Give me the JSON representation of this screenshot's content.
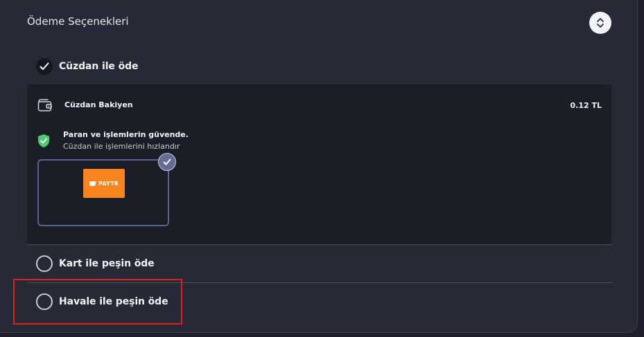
{
  "panel": {
    "title": "Ödeme Seçenekleri",
    "collapse_icon": "chevron-up-down-icon"
  },
  "options": {
    "wallet": {
      "label": "Cüzdan ile öde",
      "checked": true
    },
    "card": {
      "label": "Kart ile peşin öde",
      "checked": false
    },
    "transfer": {
      "label": "Havale ile peşin öde",
      "checked": false
    }
  },
  "wallet": {
    "title": "Cüzdan Bakiyen",
    "balance": "0.12 TL",
    "secure_title": "Paran ve işlemlerin güvende.",
    "secure_subtitle": "Cüzdan ile işlemlerini hızlandır",
    "provider": {
      "name": "PAYTR",
      "selected": true,
      "brand_color": "#f7841e"
    }
  },
  "colors": {
    "background": "#262936",
    "wallet_box": "#1c1e27",
    "highlight": "#e21b1b",
    "shield": "#4ecb71",
    "accent": "#5b6290"
  }
}
